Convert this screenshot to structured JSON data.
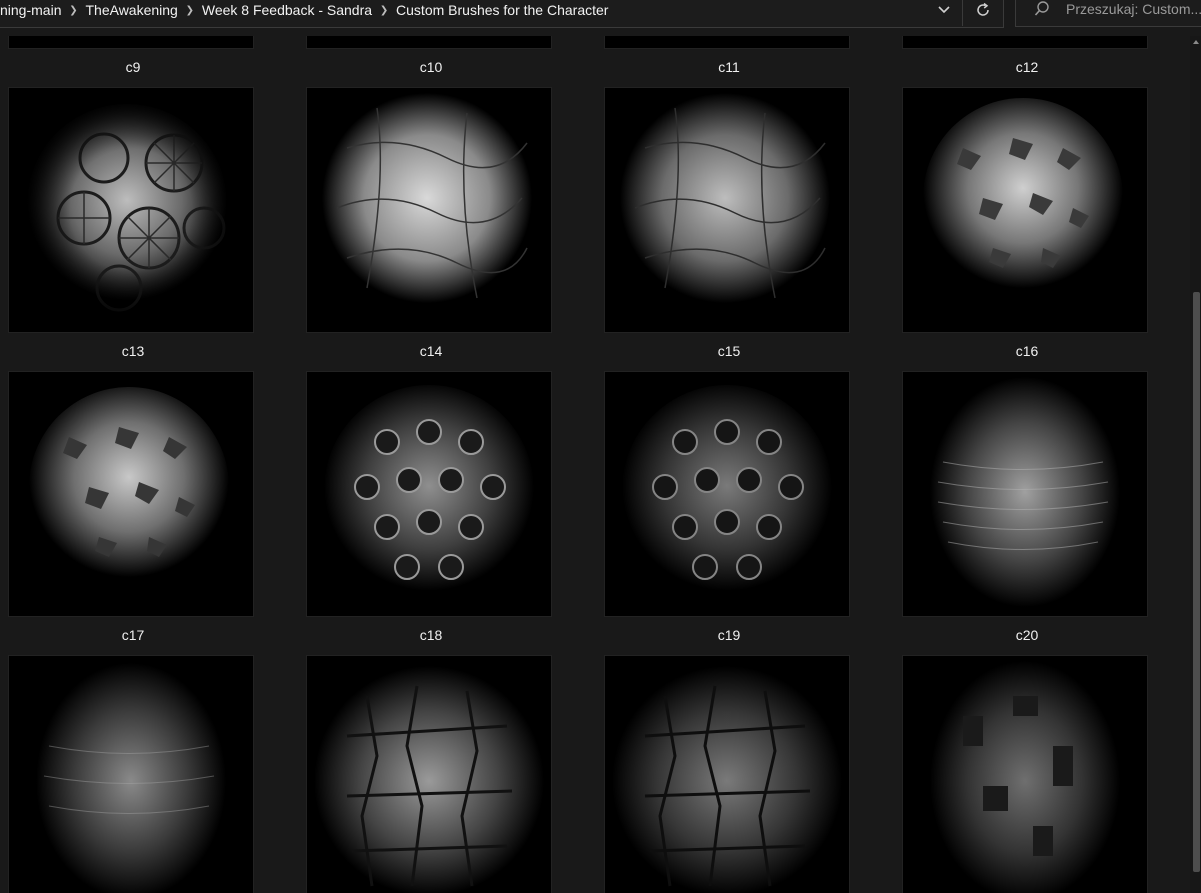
{
  "breadcrumb": [
    "ning-main",
    "TheAwakening",
    "Week 8 Feedback - Sandra",
    "Custom Brushes for the Character"
  ],
  "search": {
    "placeholder": "Przeszukaj: Custom..."
  },
  "icons": {
    "separator": "chevron-right-icon",
    "dropdown": "chevron-down-icon",
    "refresh": "refresh-icon",
    "search": "search-icon"
  },
  "files": {
    "row_top_labels": [
      "c9",
      "c10",
      "c11",
      "c12"
    ],
    "row1_labels": [
      "c13",
      "c14",
      "c15",
      "c16"
    ],
    "row2_labels": [
      "c17",
      "c18",
      "c19",
      "c20"
    ]
  }
}
